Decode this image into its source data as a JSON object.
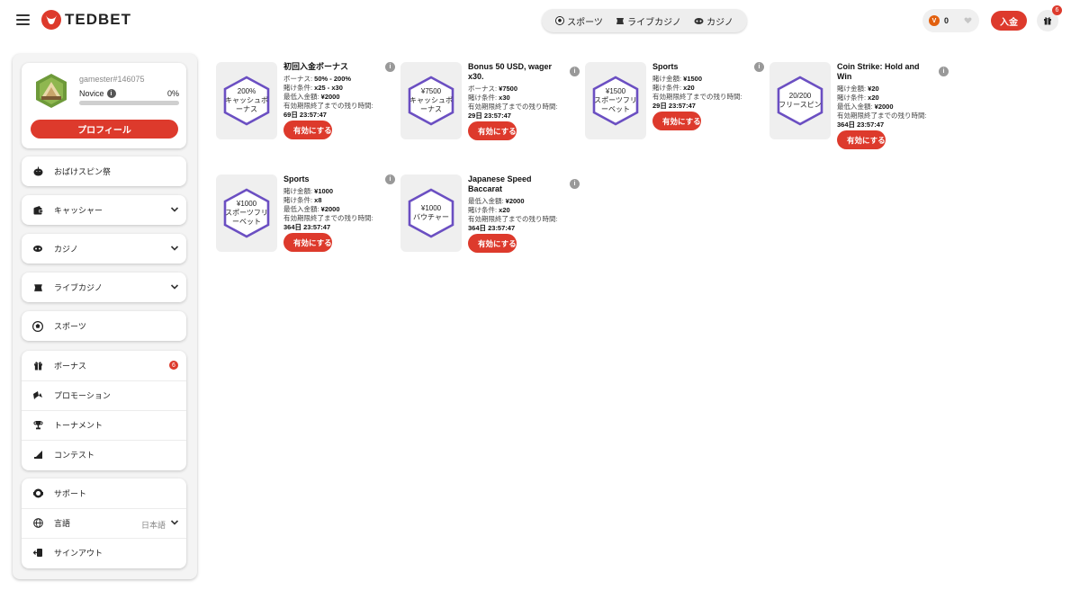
{
  "header": {
    "logo_text": "TEDBET",
    "nav": [
      {
        "label": "スポーツ",
        "icon": "soccer-ball-icon"
      },
      {
        "label": "ライブカジノ",
        "icon": "dealer-icon"
      },
      {
        "label": "カジノ",
        "icon": "slot-icon"
      }
    ],
    "wallet_currency": "V",
    "wallet_value": "0",
    "deposit_label": "入金",
    "gift_badge": "6"
  },
  "profile": {
    "username": "gamester#146075",
    "level": "Novice",
    "percent": "0%",
    "progress_fraction": 0,
    "button": "プロフィール"
  },
  "sidebar": {
    "promo": "おばけスピン祭",
    "items": [
      {
        "label": "キャッシャー"
      },
      {
        "label": "カジノ"
      },
      {
        "label": "ライブカジノ"
      },
      {
        "label": "スポーツ"
      }
    ],
    "group": [
      {
        "label": "ボーナス",
        "badge": "6"
      },
      {
        "label": "プロモーション"
      },
      {
        "label": "トーナメント"
      },
      {
        "label": "コンテスト"
      }
    ],
    "support": "サポート",
    "language_label": "言語",
    "language_value": "日本語",
    "signout": "サインアウト"
  },
  "bonuses": [
    {
      "title": "初回入金ボーナス",
      "hex": [
        "200%",
        "キャッシュボ",
        "ーナス"
      ],
      "lines": [
        {
          "k": "ボーナス: ",
          "v": "50% - 200%"
        },
        {
          "k": "賭け条件: ",
          "v": "x25 - x30"
        },
        {
          "k": "最低入金額: ",
          "v": "¥2000"
        },
        {
          "k": "有効期限終了までの残り時間:",
          "v": ""
        },
        {
          "k": "",
          "v": "69日  23:57:47"
        }
      ],
      "button": "有効にする"
    },
    {
      "title": "Bonus 50 USD, wager x30.",
      "hex": [
        "¥7500",
        "キャッシュボ",
        "ーナス"
      ],
      "lines": [
        {
          "k": "ボーナス: ",
          "v": "¥7500"
        },
        {
          "k": "賭け条件: ",
          "v": "x30"
        },
        {
          "k": "有効期限終了までの残り時間:",
          "v": ""
        },
        {
          "k": "",
          "v": "29日  23:57:47"
        }
      ],
      "button": "有効にする"
    },
    {
      "title": "Sports",
      "hex": [
        "¥1500",
        "スポーツフリ",
        "ーベット"
      ],
      "lines": [
        {
          "k": "賭け金額: ",
          "v": "¥1500"
        },
        {
          "k": "賭け条件: ",
          "v": "x20"
        },
        {
          "k": "有効期限終了までの残り時間:",
          "v": ""
        },
        {
          "k": "",
          "v": "29日  23:57:47"
        }
      ],
      "button": "有効にする"
    },
    {
      "title": "Coin Strike: Hold and Win",
      "hex": [
        "20/200",
        "フリースピン"
      ],
      "lines": [
        {
          "k": "賭け金額: ",
          "v": "¥20"
        },
        {
          "k": "賭け条件: ",
          "v": "x20"
        },
        {
          "k": "最低入金額: ",
          "v": "¥2000"
        },
        {
          "k": "有効期限終了までの残り時間:",
          "v": ""
        },
        {
          "k": "",
          "v": "364日  23:57:47"
        }
      ],
      "button": "有効にする"
    },
    {
      "title": "Sports",
      "hex": [
        "¥1000",
        "スポーツフリ",
        "ーベット"
      ],
      "lines": [
        {
          "k": "賭け金額: ",
          "v": "¥1000"
        },
        {
          "k": "賭け条件: ",
          "v": "x8"
        },
        {
          "k": "最低入金額: ",
          "v": "¥2000"
        },
        {
          "k": "有効期限終了までの残り時間:",
          "v": ""
        },
        {
          "k": "",
          "v": "364日  23:57:47"
        }
      ],
      "button": "有効にする"
    },
    {
      "title": "Japanese Speed Baccarat",
      "hex": [
        "¥1000",
        "バウチャー"
      ],
      "lines": [
        {
          "k": "最低入金額: ",
          "v": "¥2000"
        },
        {
          "k": "賭け条件: ",
          "v": "x20"
        },
        {
          "k": "有効期限終了までの残り時間:",
          "v": ""
        },
        {
          "k": "",
          "v": "364日  23:57:47"
        }
      ],
      "button": "有効にする"
    }
  ],
  "colors": {
    "accent": "#dd3a2c",
    "hex_border": "#6b4fc2",
    "sidebar_bg": "#f4f4f4"
  }
}
